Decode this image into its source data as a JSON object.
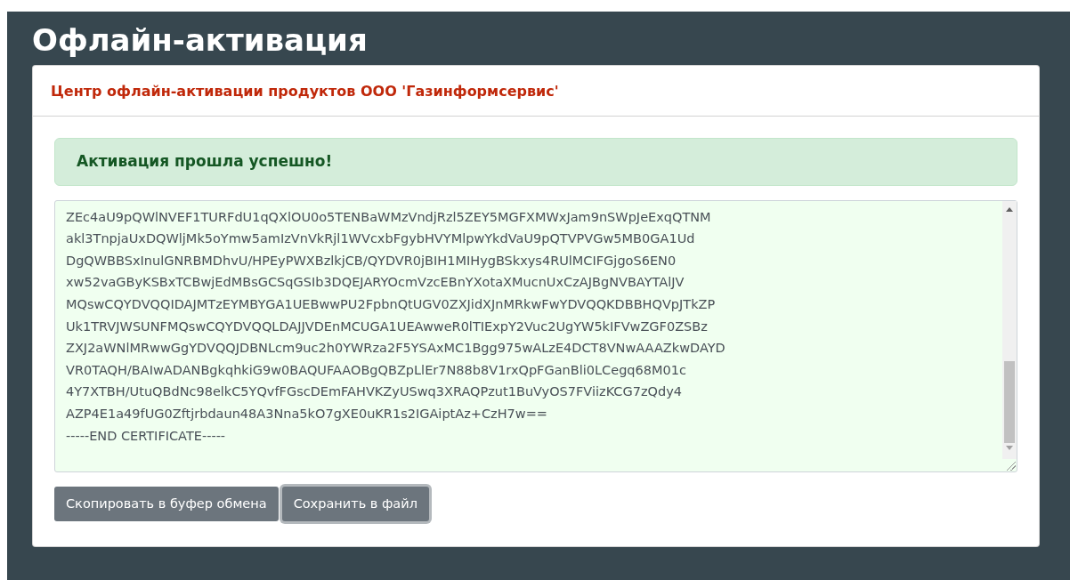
{
  "page": {
    "title": "Офлайн-активация"
  },
  "card": {
    "header": "Центр офлайн-активации продуктов ООО 'Газинформсервис'",
    "alert": "Активация прошла успешно!",
    "certificate_lines": [
      "ZEc4aU9pQWlNVEF1TURFdU1qQXlOU0o5TENBaWMzVndjRzl5ZEY5MGFXMWxJam9nSWpJeExqQTNM",
      "akl3TnpjaUxDQWljMk5oYmw5amIzVnVkRjl1WVcxbFgybHVYMlpwYkdVaU9pQTVPVGw5MB0GA1Ud",
      "DgQWBBSxInulGNRBMDhvU/HPEyPWXBzlkjCB/QYDVR0jBIH1MIHygBSkxys4RUlMCIFGjgoS6EN0",
      "xw52vaGByKSBxTCBwjEdMBsGCSqGSIb3DQEJARYOcmVzcEBnYXotaXMucnUxCzAJBgNVBAYTAlJV",
      "MQswCQYDVQQIDAJMTzEYMBYGA1UEBwwPU2FpbnQtUGV0ZXJidXJnMRkwFwYDVQQKDBBHQVpJTkZP",
      "Uk1TRVJWSUNFMQswCQYDVQQLDAJJVDEnMCUGA1UEAwweR0lTIExpY2Vuc2UgYW5kIFVwZGF0ZSBz",
      "ZXJ2aWNlMRwwGgYDVQQJDBNLcm9uc2h0YWRza2F5YSAxMC1Bgg975wALzE4DCT8VNwAAAZkwDAYD",
      "VR0TAQH/BAIwADANBgkqhkiG9w0BAQUFAAOBgQBZpLlEr7N88b8V1rxQpFGanBli0LCegq68M01c",
      "4Y7XTBH/UtuQBdNc98elkC5YQvfFGscDEmFAHVKZyUSwq3XRAQPzut1BuVyOS7FViizKCG7zQdy4",
      "AZP4E1a49fUG0Zftjrbdaun48A3Nna5kO7gXE0uKR1s2IGAiptAz+CzH7w==",
      "-----END CERTIFICATE-----"
    ],
    "buttons": [
      {
        "label": "Скопировать в буфер обмена",
        "focused": false
      },
      {
        "label": "Сохранить в файл",
        "focused": true
      }
    ]
  }
}
